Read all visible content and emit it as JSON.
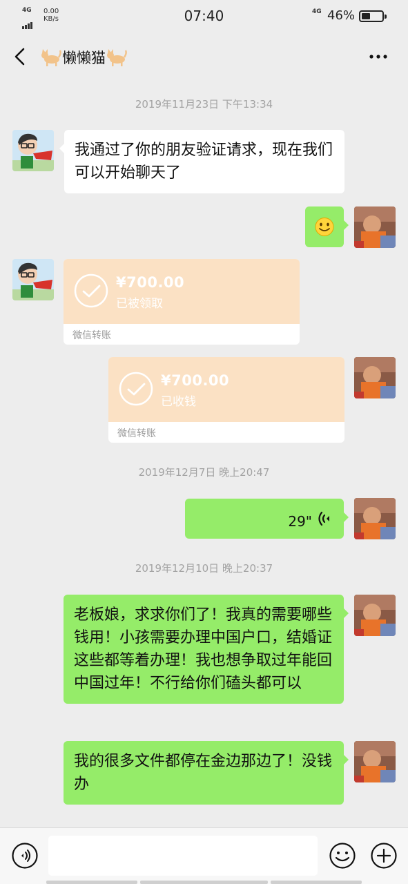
{
  "status_bar": {
    "network_left": "4G",
    "speed_value": "0.00",
    "speed_unit": "KB/s",
    "time": "07:40",
    "network_right": "4G",
    "battery_percent": "46%",
    "battery_level": 0.46
  },
  "header": {
    "title": "懒懒猫",
    "back_icon": "chevron-left-icon",
    "more_icon": "ellipsis-icon"
  },
  "messages": {
    "ts1": "2019年11月23日 下午13:34",
    "m1_text": "我通过了你的朋友验证请求，现在我们可以开始聊天了",
    "m2_emoji": "smile-emoji",
    "t1_amount": "¥700.00",
    "t1_status": "已被领取",
    "t1_footer": "微信转账",
    "t2_amount": "¥700.00",
    "t2_status": "已收钱",
    "t2_footer": "微信转账",
    "ts2": "2019年12月7日 晚上20:47",
    "voice_duration": "29\"",
    "ts3": "2019年12月10日 晚上20:37",
    "m3_text": "老板娘，求求你们了！我真的需要哪些钱用！小孩需要办理中国户口，结婚证这些都等着办理！我也想争取过年能回中国过年！不行给你们磕头都可以",
    "m4_text": "我的很多文件都停在金边那边了！没钱办"
  },
  "input_bar": {
    "placeholder": "",
    "voice_icon": "voice-mode-icon",
    "emoji_icon": "emoji-icon",
    "plus_icon": "plus-icon"
  },
  "colors": {
    "sent_bubble": "#95ec69",
    "received_bubble": "#ffffff",
    "transfer_card": "#fbe1c4",
    "background": "#ededed"
  }
}
